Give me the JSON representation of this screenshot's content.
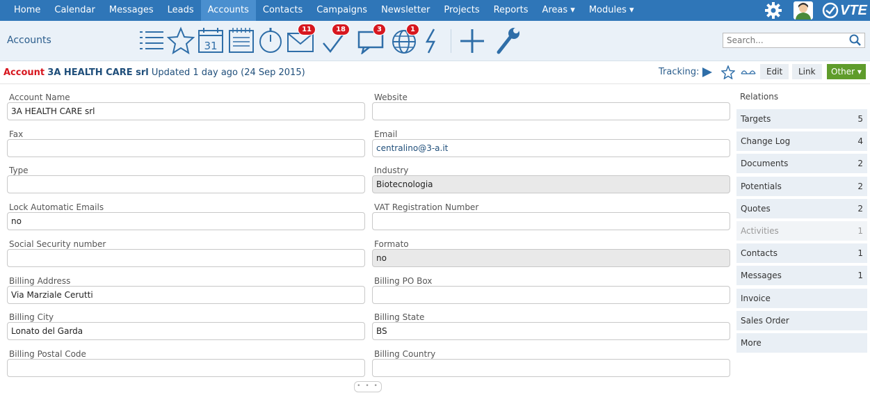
{
  "nav": {
    "items": [
      "Home",
      "Calendar",
      "Messages",
      "Leads",
      "Accounts",
      "Contacts",
      "Campaigns",
      "Newsletter",
      "Projects",
      "Reports",
      "Areas ▾",
      "Modules ▾"
    ],
    "active": "Accounts",
    "brand": "VTE"
  },
  "module": {
    "title": "Accounts",
    "calendar_day": "31",
    "badges": {
      "mail": "11",
      "tasks": "18",
      "chat": "3",
      "web": "1"
    },
    "search_placeholder": "Search..."
  },
  "record": {
    "label": "Account",
    "name": "3A HEALTH CARE srl",
    "updated": "Updated 1 day ago (24 Sep 2015)",
    "tracking": "Tracking:",
    "buttons": {
      "edit": "Edit",
      "link": "Link",
      "other": "Other ▾"
    }
  },
  "fields": {
    "left": [
      {
        "label": "Account Name",
        "value": "3A HEALTH CARE srl"
      },
      {
        "label": "Fax",
        "value": ""
      },
      {
        "label": "Type",
        "value": ""
      },
      {
        "label": "Lock Automatic Emails",
        "value": "no"
      },
      {
        "label": "Social Security number",
        "value": ""
      },
      {
        "label": "Billing Address",
        "value": "Via Marziale Cerutti"
      },
      {
        "label": "Billing City",
        "value": "Lonato del Garda"
      },
      {
        "label": "Billing Postal Code",
        "value": ""
      }
    ],
    "right": [
      {
        "label": "Website",
        "value": ""
      },
      {
        "label": "Email",
        "value": "centralino@3-a.it"
      },
      {
        "label": "Industry",
        "value": "Biotecnologia"
      },
      {
        "label": "VAT Registration Number",
        "value": ""
      },
      {
        "label": "Formato",
        "value": "no"
      },
      {
        "label": "Billing PO Box",
        "value": ""
      },
      {
        "label": "Billing State",
        "value": "BS"
      },
      {
        "label": "Billing Country",
        "value": ""
      }
    ]
  },
  "relations": {
    "title": "Relations",
    "items": [
      {
        "label": "Targets",
        "count": "5"
      },
      {
        "label": "Change Log",
        "count": "4"
      },
      {
        "label": "Documents",
        "count": "2"
      },
      {
        "label": "Potentials",
        "count": "2"
      },
      {
        "label": "Quotes",
        "count": "2"
      },
      {
        "label": "Activities",
        "count": "1"
      },
      {
        "label": "Contacts",
        "count": "1"
      },
      {
        "label": "Messages",
        "count": "1"
      },
      {
        "label": "Invoice",
        "count": ""
      },
      {
        "label": "Sales Order",
        "count": ""
      },
      {
        "label": "More",
        "count": ""
      }
    ]
  },
  "colors": {
    "nav": "#2f76b8",
    "accent_red": "#d7171f",
    "other_btn": "#5f9c2b",
    "icon_blue": "#2f6ea8"
  }
}
